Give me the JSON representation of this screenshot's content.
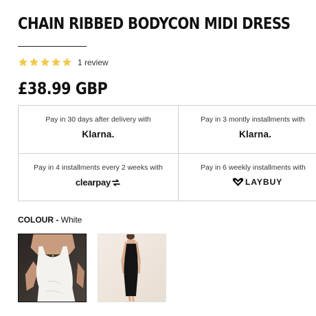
{
  "product": {
    "title": "CHAIN RIBBED BODYCON MIDI DRESS",
    "rating": {
      "stars": 5,
      "max": 5,
      "review_label": "1 review"
    },
    "price": "£38.99 GBP"
  },
  "payment_options": [
    {
      "text": "Pay in 30 days after delivery with",
      "logo": "Klarna."
    },
    {
      "text": "Pay in 3 montly installments with",
      "logo": "Klarna."
    },
    {
      "text": "Pay in 4 installments every 2 weeks with",
      "logo": "clearpay"
    },
    {
      "text": "Pay in 6 weekly installments with",
      "logo": "LAYBUY"
    }
  ],
  "colour": {
    "label": "COLOUR",
    "separator": " - ",
    "value": "White"
  },
  "swatches": [
    {
      "name": "White",
      "selected": true
    },
    {
      "name": "Black",
      "selected": false
    }
  ],
  "colors": {
    "star": "#f2c94c",
    "border": "#cfcfcf",
    "text": "#111111"
  }
}
